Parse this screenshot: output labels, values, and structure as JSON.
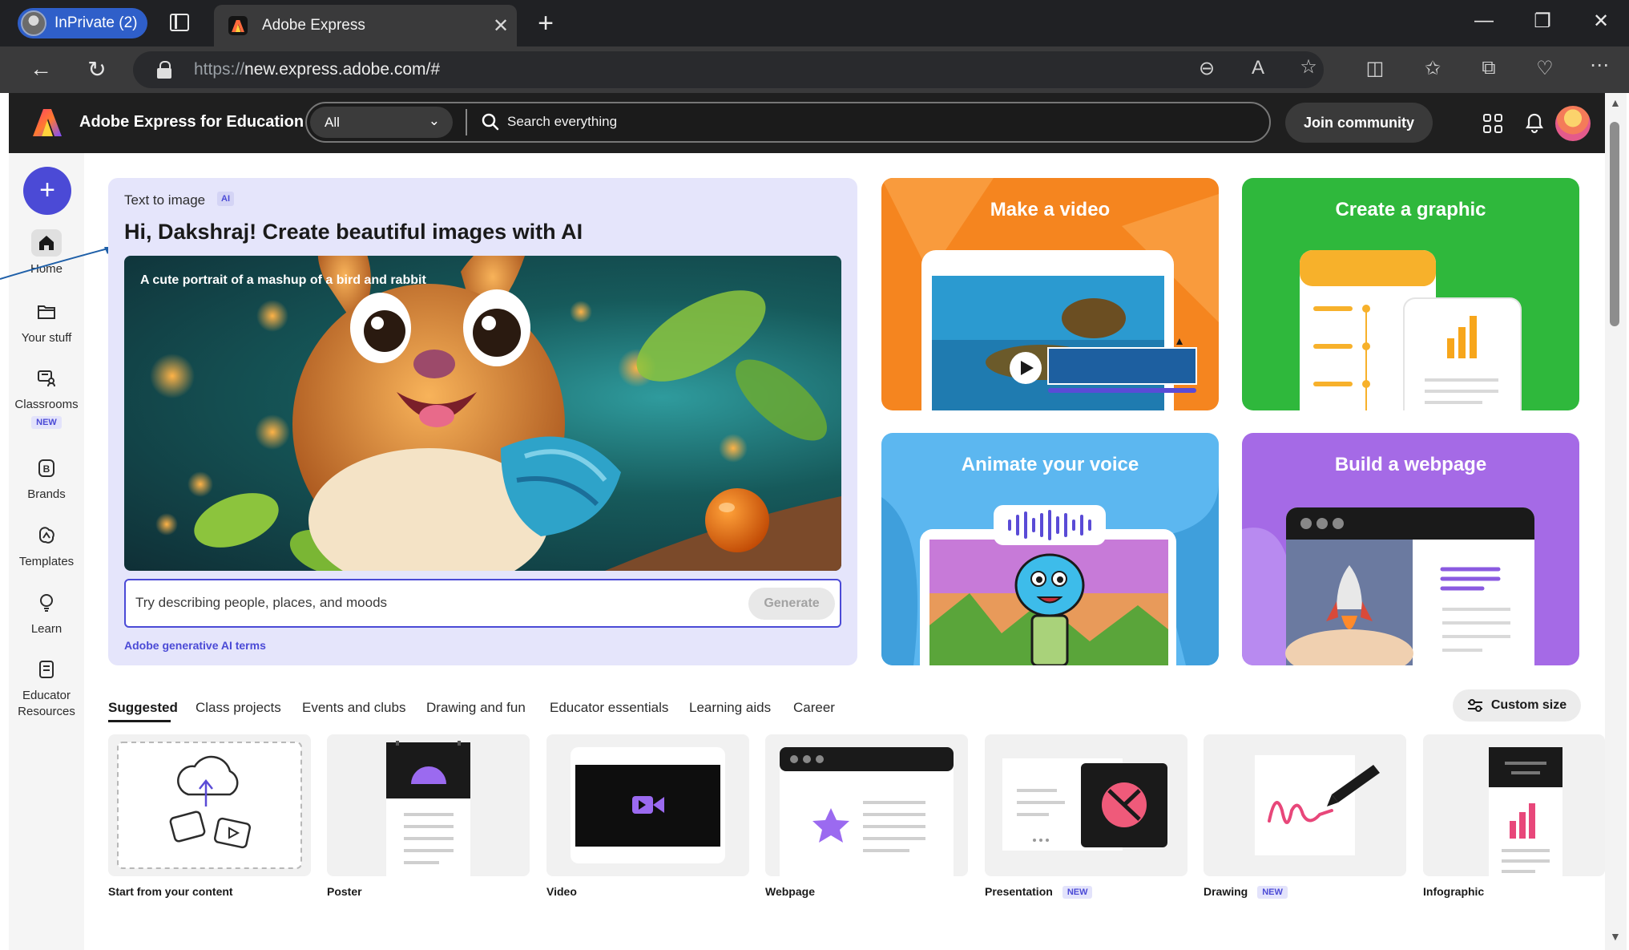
{
  "browser": {
    "profile_label": "InPrivate (2)",
    "tab_title": "Adobe Express",
    "url_scheme": "https://",
    "url_host_path": "new.express.adobe.com/#"
  },
  "header": {
    "app_title": "Adobe Express for Education",
    "filter_value": "All",
    "search_placeholder": "Search everything",
    "join_label": "Join community"
  },
  "rail": {
    "items": [
      {
        "label": "Home"
      },
      {
        "label": "Your stuff"
      },
      {
        "label": "Classrooms",
        "badge": "NEW"
      },
      {
        "label": "Brands"
      },
      {
        "label": "Templates"
      },
      {
        "label": "Learn"
      },
      {
        "label": "Educator Resources"
      }
    ]
  },
  "hero": {
    "kicker": "Text to image",
    "ai_badge": "AI",
    "title": "Hi, Dakshraj! Create beautiful images with AI",
    "image_caption": "A cute portrait of a mashup of a bird and rabbit",
    "prompt_placeholder": "Try describing people, places, and moods",
    "generate_label": "Generate",
    "terms_link": "Adobe generative AI terms"
  },
  "quick_actions": [
    {
      "title": "Make a video",
      "color": "#f5851f"
    },
    {
      "title": "Create a graphic",
      "color": "#2fb83c"
    },
    {
      "title": "Animate your voice",
      "color": "#5cb7f0"
    },
    {
      "title": "Build a webpage",
      "color": "#a56ae6"
    }
  ],
  "categories": {
    "tabs": [
      "Suggested",
      "Class projects",
      "Events and clubs",
      "Drawing and fun",
      "Educator essentials",
      "Learning aids",
      "Career"
    ],
    "active": "Suggested",
    "custom_size_label": "Custom size"
  },
  "templates": [
    {
      "label": "Start from your content"
    },
    {
      "label": "Poster"
    },
    {
      "label": "Video"
    },
    {
      "label": "Webpage"
    },
    {
      "label": "Presentation",
      "badge": "NEW"
    },
    {
      "label": "Drawing",
      "badge": "NEW"
    },
    {
      "label": "Infographic"
    }
  ],
  "colors": {
    "accent": "#4b4ad6",
    "header_bg": "#1f1f1f",
    "hero_bg": "#e5e5fb"
  }
}
